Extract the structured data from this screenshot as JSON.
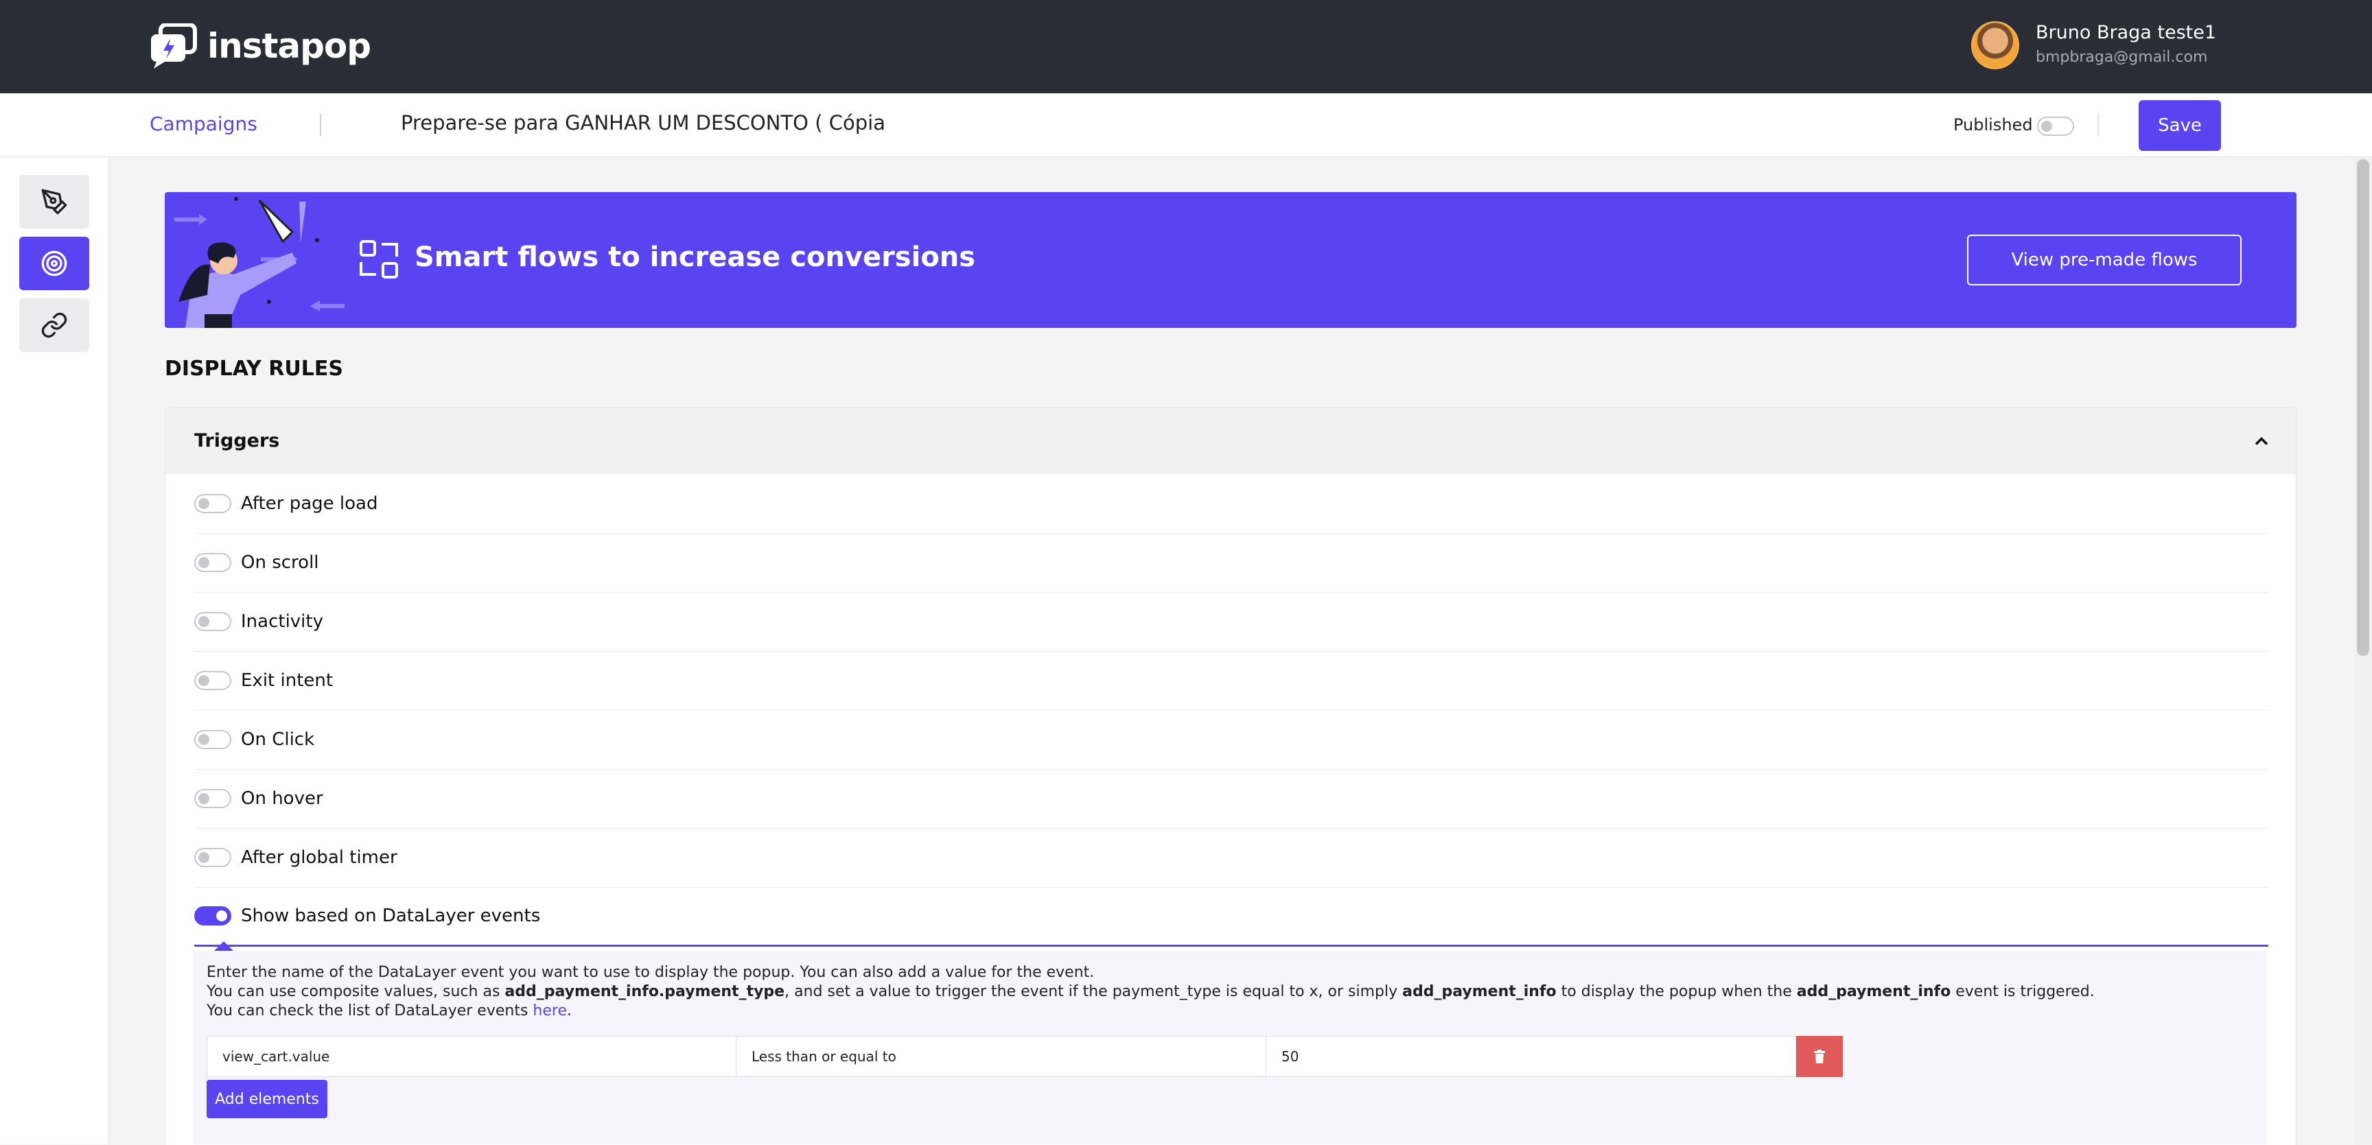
{
  "app": {
    "name": "instapop"
  },
  "user": {
    "name": "Bruno Braga teste1",
    "email": "bmpbraga@gmail.com"
  },
  "subheader": {
    "campaigns_link": "Campaigns",
    "campaign_title": "Prepare-se para GANHAR UM DESCONTO ( Cópia",
    "published_label": "Published",
    "published": false,
    "save_label": "Save"
  },
  "sidebar": {
    "items": [
      {
        "icon": "pen-tool-icon",
        "active": false
      },
      {
        "icon": "target-icon",
        "active": true
      },
      {
        "icon": "link-icon",
        "active": false
      }
    ]
  },
  "banner": {
    "title": "Smart flows to increase conversions",
    "button_label": "View pre-made flows"
  },
  "section_title": "DISPLAY RULES",
  "triggers": {
    "title": "Triggers",
    "items": [
      {
        "label": "After page load",
        "enabled": false
      },
      {
        "label": "On scroll",
        "enabled": false
      },
      {
        "label": "Inactivity",
        "enabled": false
      },
      {
        "label": "Exit intent",
        "enabled": false
      },
      {
        "label": "On Click",
        "enabled": false
      },
      {
        "label": "On hover",
        "enabled": false
      },
      {
        "label": "After global timer",
        "enabled": false
      },
      {
        "label": "Show based on DataLayer events",
        "enabled": true
      }
    ]
  },
  "datalayer": {
    "line1": "Enter the name of the DataLayer event you want to use to display the popup. You can also add a value for the event.",
    "line2_a": "You can use composite values, such as ",
    "line2_b": "add_payment_info.payment_type",
    "line2_c": ", and set a value to trigger the event if the payment_type is equal to x, or simply ",
    "line2_d": "add_payment_info",
    "line2_e": " to display the popup when the ",
    "line2_f": "add_payment_info",
    "line2_g": " event is triggered.",
    "line3_a": "You can check the list of DataLayer events ",
    "line3_link": "here",
    "line3_b": ".",
    "condition": {
      "event": "view_cart.value",
      "operator": "Less than or equal to",
      "value": "50"
    },
    "add_label": "Add elements"
  },
  "colors": {
    "accent": "#5a43f0",
    "topbar": "#2a2d36",
    "danger": "#e05a5a"
  }
}
